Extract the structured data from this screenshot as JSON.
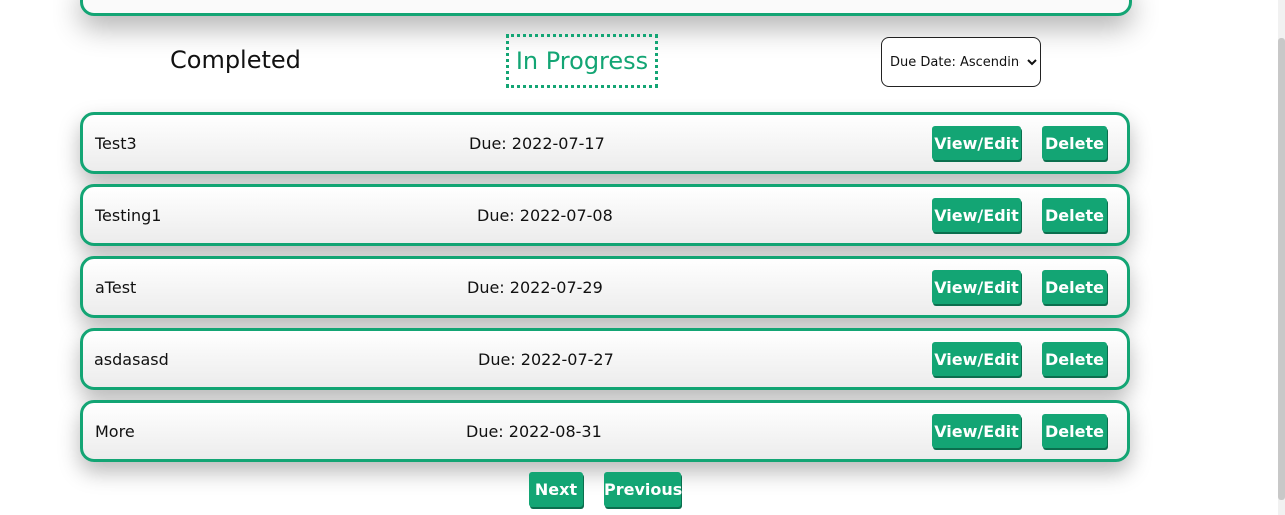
{
  "filters": {
    "completed_label": "Completed",
    "in_progress_label": "In Progress",
    "sort": {
      "selected": "Due Date: Ascending",
      "options": [
        "Due Date: Ascending"
      ]
    }
  },
  "tasks": [
    {
      "name": "Test3",
      "due": "Due: 2022-07-17",
      "edit_label": "View/Edit",
      "delete_label": "Delete"
    },
    {
      "name": "Testing1",
      "due": "Due: 2022-07-08",
      "edit_label": "View/Edit",
      "delete_label": "Delete"
    },
    {
      "name": "aTest",
      "due": "Due: 2022-07-29",
      "edit_label": "View/Edit",
      "delete_label": "Delete"
    },
    {
      "name": "asdasasd",
      "due": "Due: 2022-07-27",
      "edit_label": "View/Edit",
      "delete_label": "Delete"
    },
    {
      "name": "More",
      "due": "Due: 2022-08-31",
      "edit_label": "View/Edit",
      "delete_label": "Delete"
    }
  ],
  "pagination": {
    "next_label": "Next",
    "previous_label": "Previous"
  },
  "colors": {
    "accent": "#13a574",
    "text": "#111111",
    "background": "#ffffff"
  }
}
